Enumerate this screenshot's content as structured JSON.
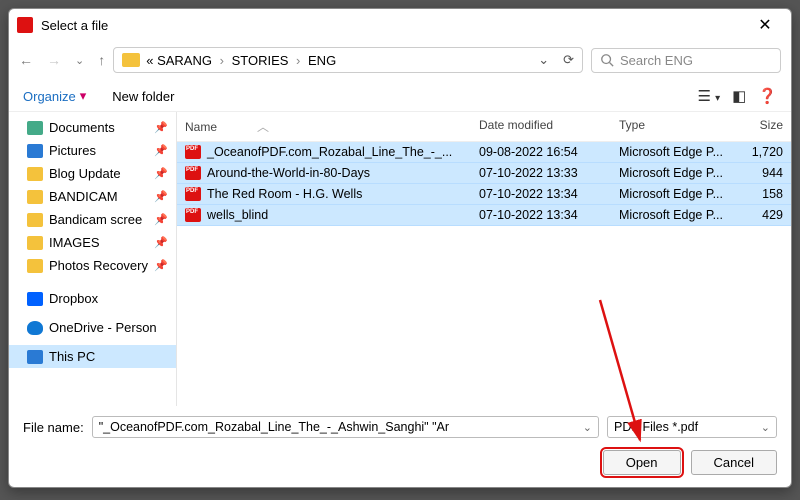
{
  "window": {
    "title": "Select a file"
  },
  "breadcrumb": {
    "prefix": "«",
    "p1": "SARANG",
    "p2": "STORIES",
    "p3": "ENG"
  },
  "search": {
    "placeholder": "Search ENG"
  },
  "toolbar": {
    "organize": "Organize",
    "newfolder": "New folder"
  },
  "sidebar": {
    "items": [
      {
        "label": "Documents",
        "icon": "doc",
        "pinned": true
      },
      {
        "label": "Pictures",
        "icon": "pic",
        "pinned": true
      },
      {
        "label": "Blog Update",
        "icon": "folder",
        "pinned": true
      },
      {
        "label": "BANDICAM",
        "icon": "folder",
        "pinned": true
      },
      {
        "label": "Bandicam scree",
        "icon": "folder",
        "pinned": true
      },
      {
        "label": "IMAGES",
        "icon": "folder",
        "pinned": true
      },
      {
        "label": "Photos Recovery",
        "icon": "folder",
        "pinned": true
      }
    ],
    "dropbox": "Dropbox",
    "onedrive": "OneDrive - Person",
    "thispc": "This PC"
  },
  "columns": {
    "name": "Name",
    "date": "Date modified",
    "type": "Type",
    "size": "Size"
  },
  "files": [
    {
      "name": "_OceanofPDF.com_Rozabal_Line_The_-_...",
      "date": "09-08-2022 16:54",
      "type": "Microsoft Edge P...",
      "size": "1,720"
    },
    {
      "name": "Around-the-World-in-80-Days",
      "date": "07-10-2022 13:33",
      "type": "Microsoft Edge P...",
      "size": "944"
    },
    {
      "name": "The Red Room - H.G. Wells",
      "date": "07-10-2022 13:34",
      "type": "Microsoft Edge P...",
      "size": "158"
    },
    {
      "name": "wells_blind",
      "date": "07-10-2022 13:34",
      "type": "Microsoft Edge P...",
      "size": "429"
    }
  ],
  "footer": {
    "filename_label": "File name:",
    "filename_value": "\"_OceanofPDF.com_Rozabal_Line_The_-_Ashwin_Sanghi\" \"Ar",
    "filter": "PDF Files *.pdf",
    "open": "Open",
    "cancel": "Cancel"
  }
}
